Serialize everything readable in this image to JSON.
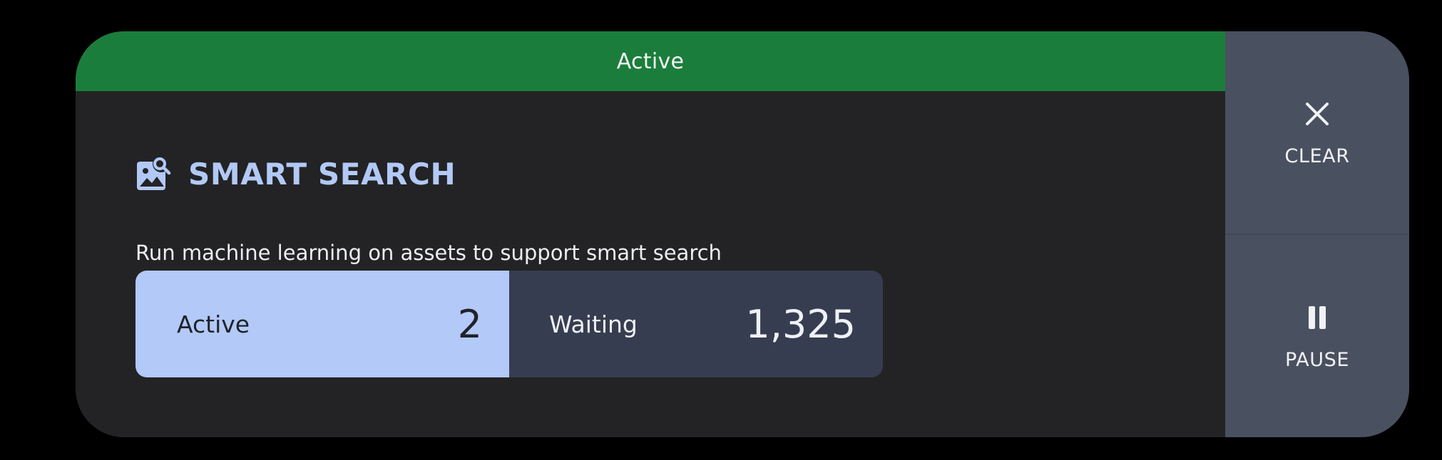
{
  "status_bar": {
    "label": "Active",
    "color": "#1b7d3c"
  },
  "job": {
    "icon": "image-search-icon",
    "title": "SMART SEARCH",
    "description": "Run machine learning on assets to support smart search",
    "title_color": "#b2c9f6"
  },
  "stats": {
    "active": {
      "label": "Active",
      "value": "2",
      "color": "#b3c9f8"
    },
    "waiting": {
      "label": "Waiting",
      "value": "1,325",
      "color": "#373d50"
    }
  },
  "actions": {
    "clear": {
      "icon": "close-icon",
      "label": "CLEAR"
    },
    "pause": {
      "icon": "pause-icon",
      "label": "PAUSE"
    }
  }
}
